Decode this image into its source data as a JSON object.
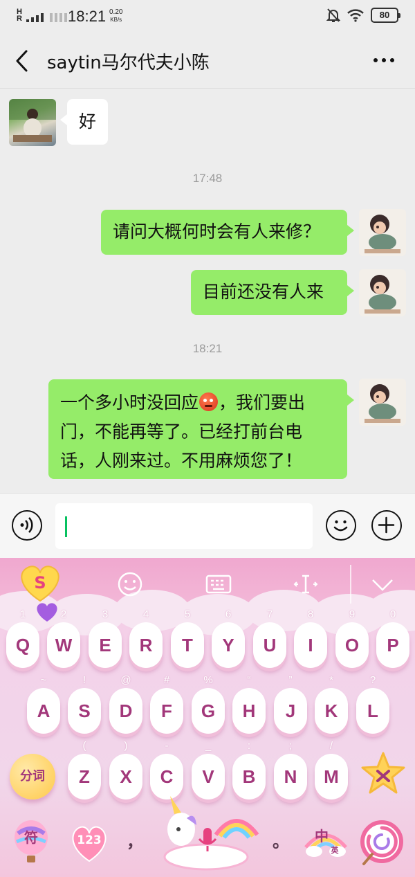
{
  "status_bar": {
    "signal_label": "H\nR",
    "time": "18:21",
    "speed_value": "0.20",
    "speed_unit": "KB/s",
    "battery": "80"
  },
  "header": {
    "title": "saytin马尔代夫小陈"
  },
  "messages": [
    {
      "side": "in",
      "text": "好"
    },
    {
      "type": "timestamp",
      "text": "17:48"
    },
    {
      "side": "out",
      "text": "请问大概何时会有人来修？"
    },
    {
      "side": "out",
      "text": "目前还没有人来"
    },
    {
      "type": "timestamp",
      "text": "18:21"
    },
    {
      "side": "out",
      "lines": [
        "一个多小时没回应",
        "，我们要出",
        "门，不能再等了。已经打前台电",
        "话，人刚来过。不用麻烦您了！"
      ]
    }
  ],
  "keyboard": {
    "row1": [
      {
        "key": "Q",
        "sub": "1"
      },
      {
        "key": "W",
        "sub": "2"
      },
      {
        "key": "E",
        "sub": "3"
      },
      {
        "key": "R",
        "sub": "4"
      },
      {
        "key": "T",
        "sub": "5"
      },
      {
        "key": "Y",
        "sub": "6"
      },
      {
        "key": "U",
        "sub": "7"
      },
      {
        "key": "I",
        "sub": "8"
      },
      {
        "key": "O",
        "sub": "9"
      },
      {
        "key": "P",
        "sub": "0"
      }
    ],
    "row2": [
      {
        "key": "A",
        "sub": "~"
      },
      {
        "key": "S",
        "sub": "!"
      },
      {
        "key": "D",
        "sub": "@"
      },
      {
        "key": "F",
        "sub": "#"
      },
      {
        "key": "G",
        "sub": "%"
      },
      {
        "key": "H",
        "sub": "“"
      },
      {
        "key": "J",
        "sub": "”"
      },
      {
        "key": "K",
        "sub": "*"
      },
      {
        "key": "L",
        "sub": "?"
      }
    ],
    "row3": [
      {
        "key": "Z",
        "sub": "("
      },
      {
        "key": "X",
        "sub": ")"
      },
      {
        "key": "C",
        "sub": "-"
      },
      {
        "key": "V",
        "sub": "_"
      },
      {
        "key": "B",
        "sub": ":"
      },
      {
        "key": "N",
        "sub": ";"
      },
      {
        "key": "M",
        "sub": "/"
      }
    ],
    "fenci": "分词",
    "symbols": "符",
    "numbers": "123",
    "comma": "，",
    "period": "。",
    "lang": "中",
    "lang_sub": "英"
  },
  "colors": {
    "outgoing_bubble": "#95ec69",
    "incoming_bubble": "#ffffff",
    "caret": "#07c160",
    "key_text": "#a2377a"
  },
  "icons": [
    "back-arrow-icon",
    "more-dots-icon",
    "voice-icon",
    "emoji-icon",
    "add-icon",
    "sogou-logo-icon",
    "smiley-icon",
    "keyboard-icon",
    "cursor-icon",
    "collapse-icon",
    "star-icon",
    "unicorn-mic-icon",
    "rainbow-icon",
    "enter-icon"
  ]
}
